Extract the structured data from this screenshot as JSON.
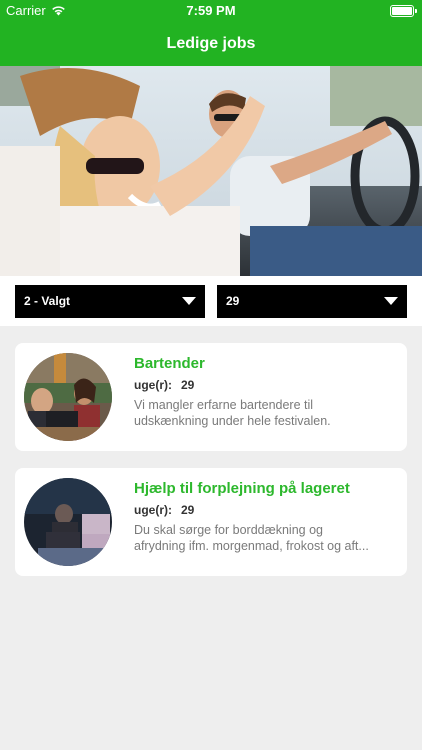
{
  "status_bar": {
    "carrier": "Carrier",
    "time": "7:59 PM"
  },
  "nav": {
    "title": "Ledige jobs"
  },
  "filters": {
    "period": {
      "selected": "2 - Valgt"
    },
    "week": {
      "selected": "29"
    }
  },
  "jobs": [
    {
      "title": "Bartender",
      "weeks_label": "uge(r):",
      "weeks_value": "29",
      "desc_line1": "Vi mangler erfarne bartendere til",
      "desc_line2": "udskænkning under hele festivalen."
    },
    {
      "title": "Hjælp til forplejning på lageret",
      "weeks_label": "uge(r):",
      "weeks_value": "29",
      "desc_line1": "Du skal sørge for borddækning og",
      "desc_line2": "afrydning ifm. morgenmad, frokost og aft..."
    }
  ],
  "colors": {
    "brand_green": "#22b322",
    "title_green": "#2db82d"
  }
}
